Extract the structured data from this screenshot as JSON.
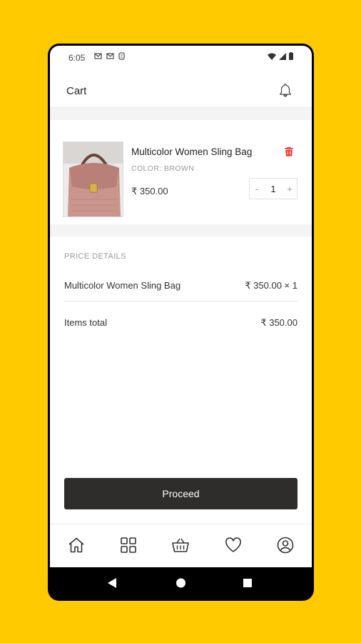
{
  "status_bar": {
    "time": "6:05"
  },
  "header": {
    "title": "Cart"
  },
  "cart_item": {
    "name": "Multicolor Women Sling Bag",
    "color": "COLOR: BROWN",
    "price": "₹ 350.00",
    "quantity": "1",
    "minus": "-",
    "plus": "+"
  },
  "price_details": {
    "heading": "PRICE DETAILS",
    "line_item": {
      "label": "Multicolor Women Sling Bag",
      "value": "₹ 350.00 × 1"
    },
    "total": {
      "label": "Items total",
      "value": "₹ 350.00"
    }
  },
  "actions": {
    "proceed_label": "Proceed"
  },
  "bottom_nav": [
    "home-icon",
    "categories-icon",
    "basket-icon",
    "heart-icon",
    "profile-icon"
  ],
  "colors": {
    "background": "#FFCA00",
    "button": "#2e2d2b",
    "delete": "#e53935"
  }
}
